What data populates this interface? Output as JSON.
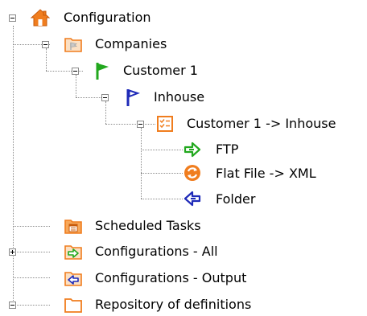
{
  "tree": {
    "items": [
      {
        "label": "Configuration",
        "icon": "home-icon"
      },
      {
        "label": "Companies",
        "icon": "companies-folder-icon"
      },
      {
        "label": "Customer 1",
        "icon": "green-flag-icon"
      },
      {
        "label": "Inhouse",
        "icon": "blue-flag-icon"
      },
      {
        "label": "Customer 1 -> Inhouse",
        "icon": "checklist-icon"
      },
      {
        "label": "FTP",
        "icon": "green-arrow-right-icon"
      },
      {
        "label": "Flat File -> XML",
        "icon": "convert-refresh-icon"
      },
      {
        "label": "Folder",
        "icon": "blue-arrow-left-icon"
      },
      {
        "label": "Scheduled Tasks",
        "icon": "calendar-folder-icon"
      },
      {
        "label": "Configurations - All",
        "icon": "folder-green-arrow-icon"
      },
      {
        "label": "Configurations - Output",
        "icon": "blue-arrow-left-folder-icon"
      },
      {
        "label": "Repository of definitions",
        "icon": "folder-icon"
      }
    ]
  },
  "colors": {
    "orange": "#f07d1e",
    "green": "#22a81e",
    "blue": "#1f2ab8",
    "connector": "#8c8c8c"
  }
}
